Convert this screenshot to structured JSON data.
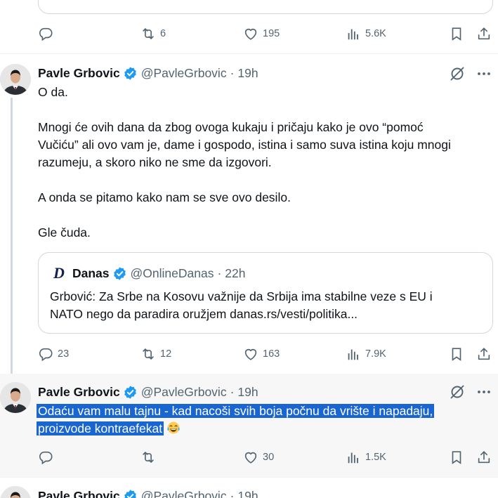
{
  "top_tweet": {
    "stats": {
      "retweets": "6",
      "likes": "195",
      "views": "5.6K"
    }
  },
  "tweet1": {
    "name": "Pavle Grbovic",
    "handle": "@PavleGrbovic",
    "separator": "·",
    "time": "19h",
    "lines": [
      "O da.",
      "",
      "Mnogi će ovih dana da zbog ovoga kukaju i pričaju kako je ovo “pomoć",
      "Vučiću” ali ovo vam je, dame i gospodo, istina i samo suva istina koju mnogi",
      "razumeju, a skoro niko ne sme da izgovori.",
      "",
      "A onda se pitamo kako nam se sve ovo desilo.",
      "",
      "Gle čuda."
    ],
    "quote": {
      "logo_letter": "D",
      "name": "Danas",
      "handle": "@OnlineDanas",
      "separator": "·",
      "time": "22h",
      "line1": "Grbović: Za Srbe na Kosovu važnije da Srbija ima stabilne veze s EU i",
      "line2": "NATO nego da paradira oružjem danas.rs/vesti/politika..."
    },
    "stats": {
      "replies": "23",
      "retweets": "12",
      "likes": "163",
      "views": "7.9K"
    }
  },
  "tweet2": {
    "name": "Pavle Grbovic",
    "handle": "@PavleGrbovic",
    "separator": "·",
    "time": "19h",
    "line1": "Odaću vam malu tajnu - kad nacoši svih boja počnu da vrište i napadaju,",
    "line2": "proizvode kontraefekat",
    "emoji": "face-with-tears-of-joy",
    "stats": {
      "likes": "30",
      "views": "1.5K"
    }
  },
  "tweet3": {
    "name": "Pavle Grbovic",
    "handle": "@PavleGrbovic",
    "separator": "·",
    "time": "19h"
  },
  "colors": {
    "verified": "#1d9bf0",
    "muted": "#536471",
    "highlight": "#1a66d1",
    "hover_bg": "#f7f7f7"
  }
}
